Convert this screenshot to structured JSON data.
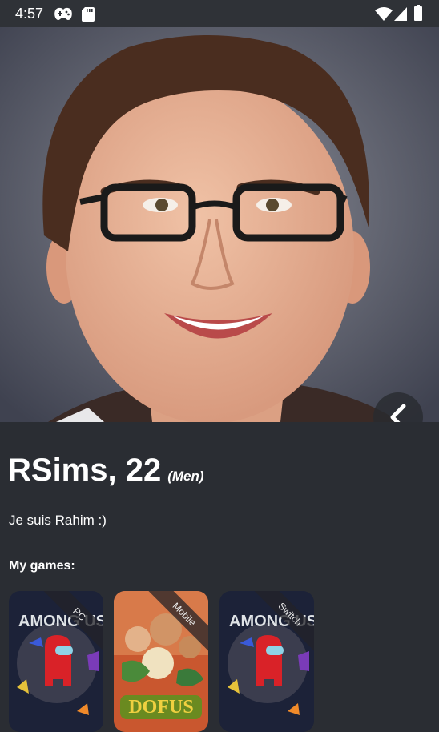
{
  "status_bar": {
    "time": "4:57",
    "left_icons": [
      "gamepad-icon",
      "sd-card-icon"
    ],
    "right_icons": [
      "wifi-icon",
      "signal-icon",
      "battery-icon"
    ]
  },
  "profile": {
    "name_age": "RSims, 22",
    "gender": "(Men)",
    "bio": "Je suis Rahim :)",
    "games_title": "My games:",
    "games": [
      {
        "title": "AMONG US",
        "platform": "PC"
      },
      {
        "title": "DOFUS",
        "platform": "Mobile"
      },
      {
        "title": "AMONG US",
        "platform": "Switch"
      }
    ]
  },
  "colors": {
    "background": "#2a2d33",
    "status_bar": "#2f3237",
    "text": "#ffffff"
  }
}
